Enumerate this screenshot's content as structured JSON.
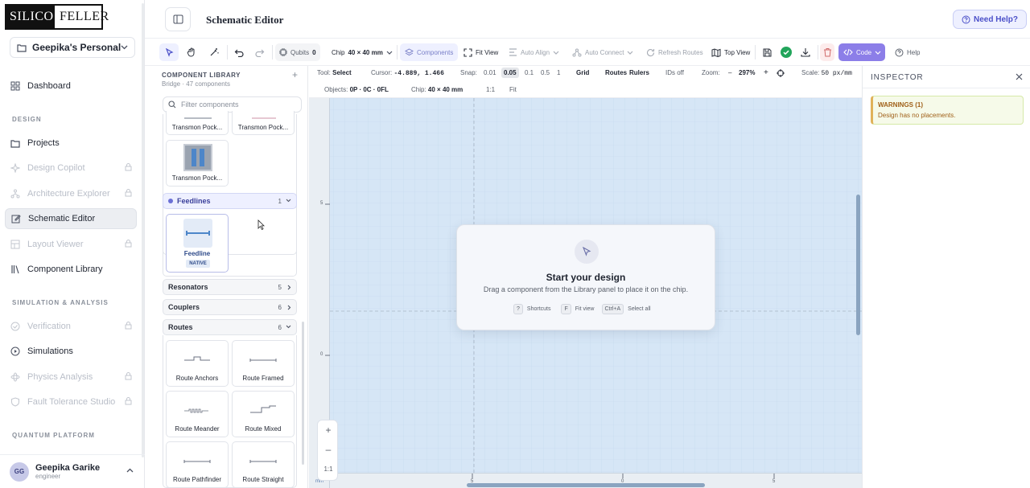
{
  "brand": {
    "logo_left": "SILICO",
    "logo_right": "FELLER"
  },
  "workspace": {
    "label": "Geepika's Personal ..."
  },
  "sidebar": {
    "dashboard": "Dashboard",
    "design_section": "DESIGN",
    "items": [
      {
        "label": "Projects"
      },
      {
        "label": "Design Copilot"
      },
      {
        "label": "Architecture Explorer"
      },
      {
        "label": "Schematic Editor"
      },
      {
        "label": "Layout Viewer"
      },
      {
        "label": "Component Library"
      }
    ],
    "sim_section": "SIMULATION & ANALYSIS",
    "sim_items": [
      {
        "label": "Verification"
      },
      {
        "label": "Simulations"
      },
      {
        "label": "Physics Analysis"
      },
      {
        "label": "Fault Tolerance Studio"
      }
    ],
    "quantum_section": "QUANTUM PLATFORM"
  },
  "user": {
    "initials": "GG",
    "name": "Geepika Garike",
    "role": "engineer"
  },
  "header": {
    "title": "Schematic Editor",
    "help": "Need Help?"
  },
  "toolbar": {
    "qubits_label": "Qubits",
    "qubits_value": "0",
    "chip_label": "Chip",
    "chip_value": "40 × 40 mm",
    "components": "Components",
    "fit_view": "Fit View",
    "auto_align": "Auto Align",
    "auto_connect": "Auto Connect",
    "refresh_routes": "Refresh Routes",
    "top_view": "Top View",
    "code": "Code",
    "help": "Help"
  },
  "library": {
    "title": "COMPONENT LIBRARY",
    "subtitle": "Bridge · 47 components",
    "filter_placeholder": "Filter components",
    "top_cards": [
      "Transmon Pock...",
      "Transmon Pock..."
    ],
    "third_card": "Transmon Pock...",
    "categories": {
      "feedlines": {
        "label": "Feedlines",
        "count": "1"
      },
      "resonators": {
        "label": "Resonators",
        "count": "5"
      },
      "couplers": {
        "label": "Couplers",
        "count": "6"
      },
      "routes": {
        "label": "Routes",
        "count": "6"
      }
    },
    "feedline_card": {
      "label": "Feedline",
      "badge": "NATIVE"
    },
    "route_cards": [
      "Route Anchors",
      "Route Framed",
      "Route Meander",
      "Route Mixed",
      "Route Pathfinder",
      "Route Straight"
    ]
  },
  "status": {
    "tool_label": "Tool:",
    "tool_value": "Select",
    "cursor_label": "Cursor:",
    "cursor_value": "-4.889, 1.466",
    "snap_label": "Snap:",
    "snap_values": [
      "0.01",
      "0.05",
      "0.1",
      "0.5",
      "1"
    ],
    "grid": "Grid",
    "routes": "Routes",
    "rulers": "Rulers",
    "ids": "IDs off",
    "zoom_label": "Zoom:",
    "zoom_value": "297%",
    "scale_label": "Scale:",
    "scale_value": "50 px/mm",
    "objects_label": "Objects:",
    "objects_value": "0P · 0C · 0FL",
    "chip_label": "Chip:",
    "chip_value": "40 × 40 mm",
    "one_to_one": "1:1",
    "fit": "Fit"
  },
  "canvas": {
    "ruler_v": [
      "5",
      "0"
    ],
    "ruler_h": [
      "5",
      "0",
      "5"
    ],
    "ruler_corner": "mm",
    "empty_title": "Start your design",
    "empty_sub": "Drag a component from the Library panel to place it on the chip.",
    "keys": [
      {
        "key": "?",
        "label": "Shortcuts"
      },
      {
        "key": "F",
        "label": "Fit view"
      },
      {
        "key": "Ctrl+A",
        "label": "Select all"
      }
    ],
    "zoom_reset": "1:1"
  },
  "inspector": {
    "title": "INSPECTOR",
    "warn_title": "WARNINGS (1)",
    "warn_msg": "Design has no placements."
  },
  "colors": {
    "accent": "#4b50c9",
    "canvas": "#d6e6f6",
    "warning": "#a06018",
    "success": "#22a55b"
  }
}
